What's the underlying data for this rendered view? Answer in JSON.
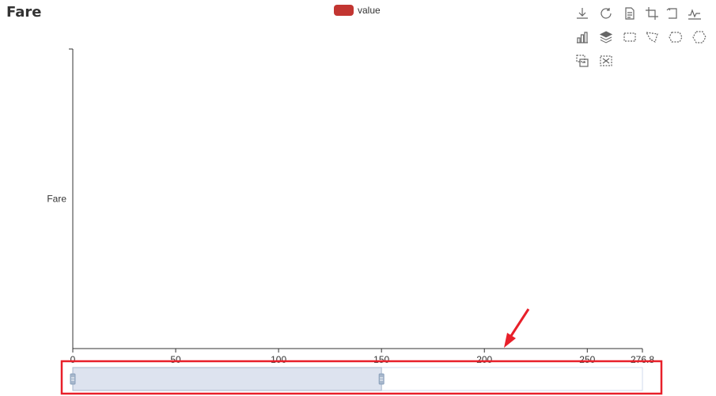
{
  "title": "Fare",
  "legend": {
    "label": "value",
    "color": "#c23531"
  },
  "toolbox": {
    "icons": [
      "download-icon",
      "refresh-icon",
      "data-view-icon",
      "zoom-icon",
      "zoom-back-icon",
      "line-chart-icon",
      "bar-chart-icon",
      "stack-icon",
      "rect-select-icon",
      "lasso-select-icon",
      "keep-select-icon",
      "clear-select-icon",
      "data-zoom-icon",
      "data-zoom-reset-icon"
    ]
  },
  "chart_data": {
    "type": "bar",
    "title": "Fare",
    "categories": [
      "Fare"
    ],
    "series": [
      {
        "name": "value",
        "values": []
      }
    ],
    "xlim": [
      0,
      276.8
    ],
    "x_ticks": [
      "0",
      "50",
      "100",
      "150",
      "200",
      "250",
      "276.8"
    ],
    "y_ticks": [
      "Fare"
    ],
    "grid": false,
    "legend_position": "top-center",
    "data_zoom": {
      "start": 0,
      "end": 150
    }
  },
  "annotation": {
    "color": "#e8202a"
  }
}
